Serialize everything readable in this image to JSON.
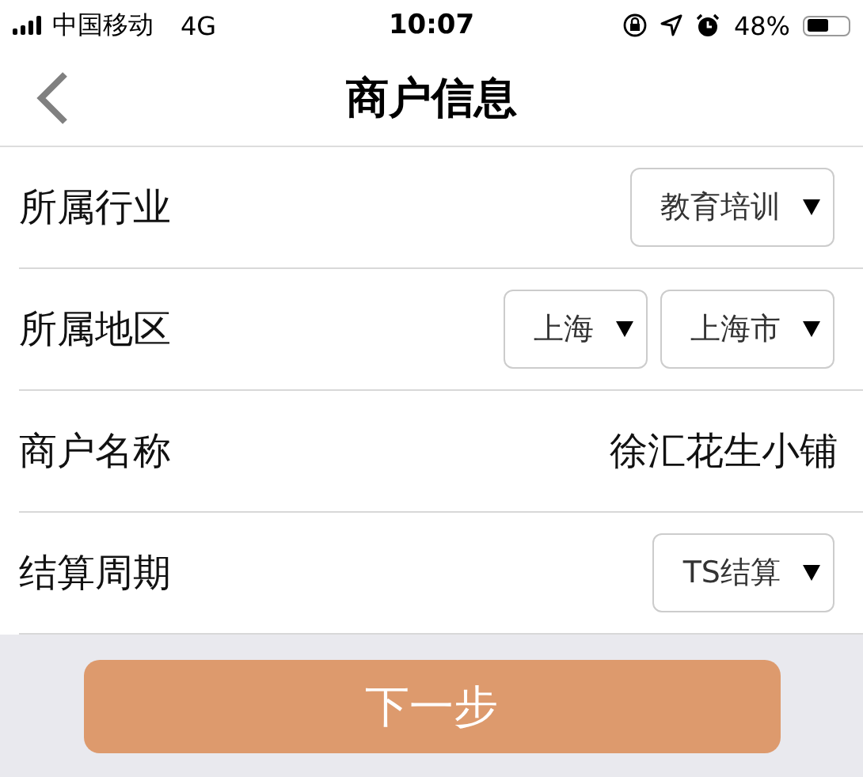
{
  "status_bar": {
    "carrier": "中国移动",
    "network": "4G",
    "time": "10:07",
    "battery": "48%"
  },
  "nav": {
    "title": "商户信息"
  },
  "rows": [
    {
      "label": "所属行业",
      "kind": "select",
      "selects": [
        "教育培训"
      ]
    },
    {
      "label": "所属地区",
      "kind": "select",
      "selects": [
        "上海",
        "上海市"
      ]
    },
    {
      "label": "商户名称",
      "kind": "text",
      "value": "徐汇花生小铺"
    },
    {
      "label": "结算周期",
      "kind": "select",
      "selects": [
        "TS结算"
      ]
    }
  ],
  "next_button": {
    "label": "下一步"
  }
}
